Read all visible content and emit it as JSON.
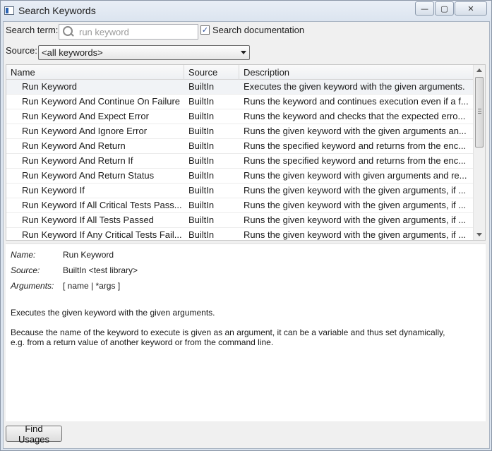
{
  "window": {
    "title": "Search Keywords",
    "controls": {
      "minimize": "—",
      "maximize": "▢",
      "close": "✕"
    }
  },
  "search": {
    "label": "Search term:",
    "placeholder": "run keyword",
    "value": "",
    "documentation_checkbox": {
      "label": "Search documentation",
      "checked": true,
      "mark": "✓"
    }
  },
  "source": {
    "label": "Source:",
    "selected": "<all keywords>"
  },
  "table": {
    "columns": [
      "Name",
      "Source",
      "Description"
    ],
    "rows": [
      {
        "name": "Run Keyword",
        "source": "BuiltIn",
        "description": "Executes the given keyword with the given arguments."
      },
      {
        "name": "Run Keyword And Continue On Failure",
        "source": "BuiltIn",
        "description": "Runs the keyword and continues execution even if a f..."
      },
      {
        "name": "Run Keyword And Expect Error",
        "source": "BuiltIn",
        "description": "Runs the keyword and checks that the expected erro..."
      },
      {
        "name": "Run Keyword And Ignore Error",
        "source": "BuiltIn",
        "description": "Runs the given keyword with the given arguments an..."
      },
      {
        "name": "Run Keyword And Return",
        "source": "BuiltIn",
        "description": "Runs the specified keyword and returns from the enc..."
      },
      {
        "name": "Run Keyword And Return If",
        "source": "BuiltIn",
        "description": "Runs the specified keyword and returns from the enc..."
      },
      {
        "name": "Run Keyword And Return Status",
        "source": "BuiltIn",
        "description": "Runs the given keyword with given arguments and re..."
      },
      {
        "name": "Run Keyword If",
        "source": "BuiltIn",
        "description": "Runs the given keyword with the given arguments, if ..."
      },
      {
        "name": "Run Keyword If All Critical Tests Pass...",
        "source": "BuiltIn",
        "description": "Runs the given keyword with the given arguments, if ..."
      },
      {
        "name": "Run Keyword If All Tests Passed",
        "source": "BuiltIn",
        "description": "Runs the given keyword with the given arguments, if ..."
      },
      {
        "name": "Run Keyword If Any Critical Tests Fail...",
        "source": "BuiltIn",
        "description": "Runs the given keyword with the given arguments, if ..."
      }
    ]
  },
  "details": {
    "name_label": "Name:",
    "name_value": "Run Keyword",
    "source_label": "Source:",
    "source_value": "BuiltIn <test library>",
    "arguments_label": "Arguments:",
    "arguments_value": "[ name | *args ]",
    "doc_line1": "Executes the given keyword with the given arguments.",
    "doc_line2": "Because the name of the keyword to execute is given as an argument, it can be a variable and thus set dynamically,",
    "doc_line3": "e.g. from a return value of another keyword or from the command line."
  },
  "buttons": {
    "find_usages": "Find Usages"
  }
}
